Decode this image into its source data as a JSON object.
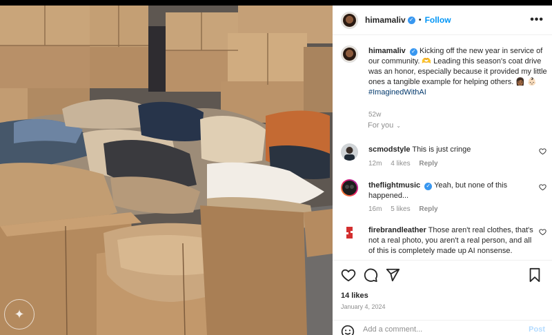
{
  "post": {
    "username": "himamaliv",
    "follow_label": "Follow",
    "separator": "•",
    "more_label": "•••"
  },
  "caption": {
    "username": "himamaliv",
    "text_part1": "Kicking off the new year in service of our community. 🫶 Leading this season's coat drive was an honor, especially because it provided my little ones a tangible example for helping others. 👩🏾 👶🏻 ",
    "hashtag": "#ImaginedWithAI",
    "age": "52w"
  },
  "for_you": {
    "label": "For you",
    "chevron": "⌄"
  },
  "comments": [
    {
      "username": "scmodstyle",
      "text": "This is just cringe",
      "age": "12m",
      "likes": "4 likes",
      "reply": "Reply"
    },
    {
      "username": "theflightmusic",
      "text": "Yeah, but none of this happened...",
      "age": "16m",
      "likes": "5 likes",
      "reply": "Reply"
    },
    {
      "username": "firebrandleather",
      "text": "Those aren't real clothes, that's not a real photo, you aren't a real person, and all of this is completely made up AI nonsense.",
      "age": "",
      "likes": "",
      "reply": ""
    }
  ],
  "actions": {
    "likes_count": "14 likes",
    "date": "January 4, 2024",
    "add_comment_placeholder": "Add a comment...",
    "post_label": "Post"
  },
  "icons": {
    "heart": "heart-icon",
    "comment": "comment-icon",
    "share": "share-icon",
    "bookmark": "bookmark-icon",
    "emoji": "emoji-icon",
    "verified": "verified-badge-icon",
    "ai_badge": "imagined-with-ai-icon"
  },
  "colors": {
    "link_blue": "#0095f6",
    "verified_blue": "#3897f0",
    "hashtag": "#00376b",
    "muted": "#8e8e8e"
  }
}
